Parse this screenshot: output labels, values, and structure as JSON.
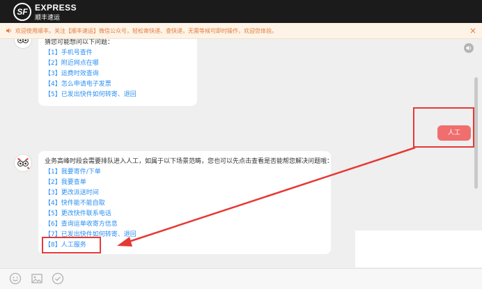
{
  "header": {
    "logo_mark": "SF",
    "logo_title": "EXPRESS",
    "logo_subtitle": "顺丰速运"
  },
  "notice": {
    "text": "欢迎使用顺丰。关注【顺丰速运】微信公众号，轻松寄快递、查快递，无需等候可即时操作，欢迎您体验。",
    "close": "×"
  },
  "chat": {
    "message1": {
      "intro": "猜您可能想问以下问题：",
      "options": [
        "【1】手机号查件",
        "【2】附近网点在哪",
        "【3】运费时效查询",
        "【4】怎么申请电子发票",
        "【5】已发出快件如何转寄、退回"
      ]
    },
    "user_message": "人工",
    "message2": {
      "intro": "业务高峰时段会需要排队进入人工，如属于以下场景范畴，您也可以先点击查看是否能帮您解决问题哦：",
      "options": [
        "【1】我要寄件/下单",
        "【2】我要查单",
        "【3】更改派送时间",
        "【4】快件能不能自取",
        "【5】更改快件联系电话",
        "【6】查询运单收寄方信息",
        "【7】已发出快件如何转寄、退回",
        "【8】人工服务"
      ]
    }
  },
  "colors": {
    "header_bg": "#1b1b1b",
    "notice_text": "#e47c3f",
    "link": "#2a8ff2",
    "user_bubble": "#f06e6e",
    "annotation_red": "#e53935"
  },
  "icons": {
    "notice": "speaker-icon",
    "sound": "sound-icon",
    "emoji": "emoji-icon",
    "image": "image-icon",
    "evaluate": "check-circle-icon"
  }
}
